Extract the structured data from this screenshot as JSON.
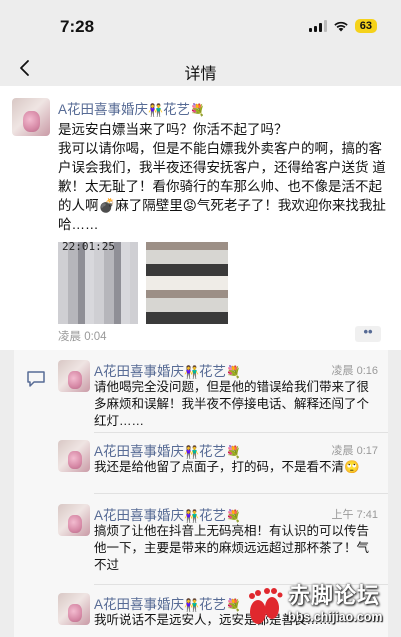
{
  "status_bar": {
    "time": "7:28",
    "battery": "63"
  },
  "nav": {
    "title": "详情"
  },
  "post": {
    "author": "A花田喜事婚庆",
    "author_emoji_1": "👫",
    "author_mid": "花艺",
    "author_emoji_2": "💐",
    "text": "是远安白嫖当来了吗？你活不起了吗？\n我可以请你喝，但是不能白嫖我外卖客户的啊，搞的客户误会我们，我半夜还得安抚客户，还得给客户送货 道歉！太无耻了！看你骑行的车那么帅、也不像是活不起的人啊💣麻了隔壁里😡气死老子了！我欢迎你来找我扯哈……",
    "image_timestamp": "22:01:25",
    "time": "凌晨 0:04",
    "more_label": "••"
  },
  "comments": [
    {
      "author": "A花田喜事婚庆",
      "emoji_1": "👫",
      "mid": "花艺",
      "emoji_2": "💐",
      "time": "凌晨 0:16",
      "text": "请他喝完全没问题，但是他的错误给我们带来了很多麻烦和误解！我半夜不停接电话、解释还闯了个红灯……"
    },
    {
      "author": "A花田喜事婚庆",
      "emoji_1": "👫",
      "mid": "花艺",
      "emoji_2": "💐",
      "time": "凌晨 0:17",
      "text": "我还是给他留了点面子，打的码，不是看不清🙄"
    },
    {
      "author": "A花田喜事婚庆",
      "emoji_1": "👫",
      "mid": "花艺",
      "emoji_2": "💐",
      "time": "上午 7:41",
      "text": "搞烦了让他在抖音上无码亮相！有认识的可以传告他一下，主要是带来的麻烦远远超过那杯茶了！气不过"
    },
    {
      "author": "A花田喜事婚庆",
      "emoji_1": "👫",
      "mid": "花艺",
      "emoji_2": "💐",
      "time": "",
      "text": "我听说话不是远安人，远安是都是善良……"
    }
  ],
  "watermark": {
    "title": "赤脚论坛",
    "url": "bbs.chijiao.com"
  },
  "colors": {
    "link": "#576b95",
    "battery": "#f5d21b",
    "background": "#ededed",
    "comment_bg": "#f7f7f7"
  }
}
